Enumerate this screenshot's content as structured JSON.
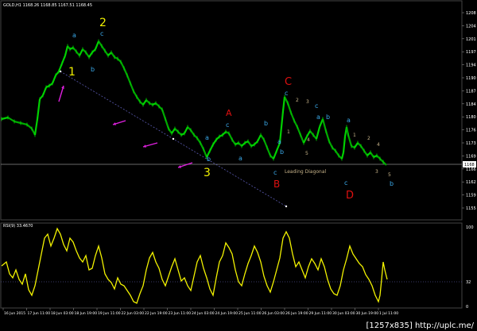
{
  "header": {
    "symbol_info": "GOLD,H1  1168.26  1168.85  1167.51  1168.45"
  },
  "rsi": {
    "label": "RSI(9) 33.4670",
    "axis_ticks": [
      "100",
      "32",
      "0"
    ]
  },
  "axis": {
    "price_ticks": [
      "1208",
      "1204",
      "1201",
      "1197",
      "1194",
      "1190",
      "1187",
      "1184",
      "1180",
      "1176",
      "1173",
      "1169",
      "1166",
      "1162",
      "1159",
      "1155"
    ],
    "current_price": "1168"
  },
  "time_axis": [
    "16 Jun 2015",
    "17 Jun 11:00",
    "18 Jun 03:00",
    "18 Jun 19:00",
    "19 Jun 11:00",
    "22 Jun 03:00",
    "22 Jun 19:00",
    "23 Jun 11:00",
    "24 Jun 03:00",
    "24 Jun 19:00",
    "25 Jun 11:00",
    "26 Jun 03:00",
    "26 Jun 19:00",
    "29 Jun 11:00",
    "30 Jun 03:00",
    "30 Jun 19:00",
    "1 Jul 11:00"
  ],
  "wave_labels": {
    "w1": "1",
    "w2": "2",
    "w3": "3",
    "wA": "A",
    "wB": "B",
    "wC": "C",
    "wD": "D",
    "a1": "a",
    "b1": "b",
    "c1": "c",
    "a2": "a",
    "b2": "b",
    "c2": "c",
    "a3": "a",
    "b3": "b",
    "c3": "c",
    "a4": "a",
    "b4": "b",
    "c4": "c",
    "a5": "a",
    "b5": "b",
    "c5": "c",
    "a6": "a",
    "b6": "b",
    "c6": "c",
    "n1": "1",
    "n2": "2",
    "n3": "3",
    "n4": "4",
    "n5": "5",
    "m1": "1",
    "m2": "2",
    "m3": "3",
    "m4": "4",
    "m5": "5",
    "diag": "Leading Diagonal"
  },
  "watermark": "[1257x835] http://uplc.me/",
  "colors": {
    "price": "#00cc00",
    "rsi": "#f2f200",
    "wave_major_yellow": "#f2f200",
    "wave_major_red": "#e01010",
    "wave_minor_blue": "#3aa8e8",
    "arrow": "#e020e0",
    "label_gray": "#c8b48a"
  }
}
